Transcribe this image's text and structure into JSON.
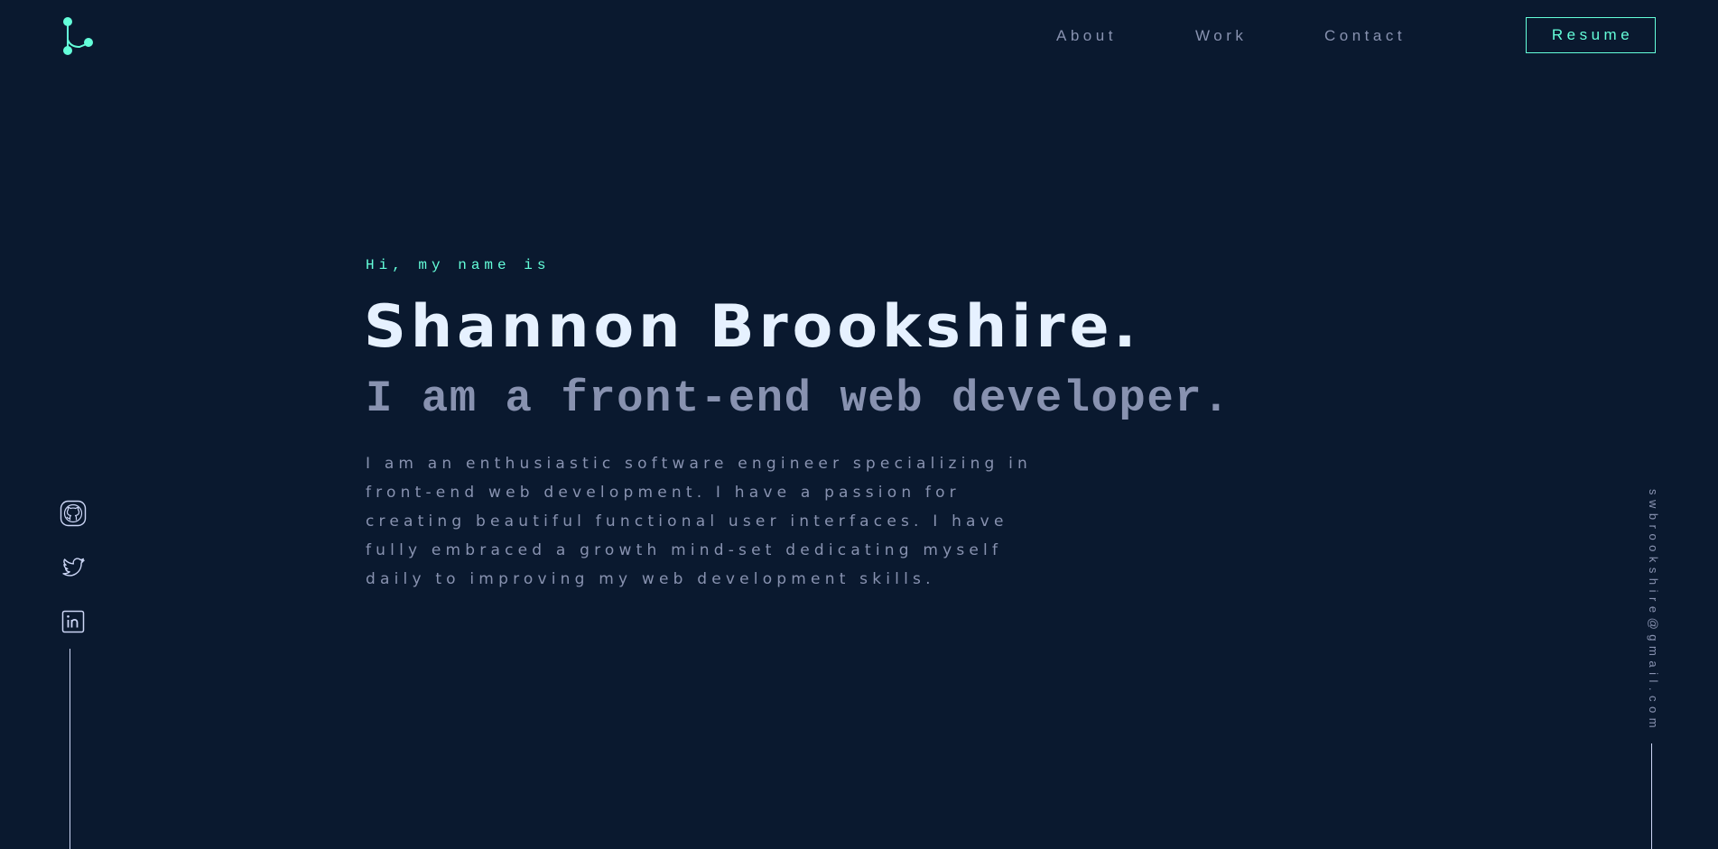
{
  "nav": {
    "links": [
      {
        "label": "About"
      },
      {
        "label": "Work"
      },
      {
        "label": "Contact"
      }
    ],
    "resume_label": "Resume"
  },
  "logo": {
    "icon": "logo-icon"
  },
  "hero": {
    "greeting": "Hi, my name is",
    "name": "Shannon Brookshire.",
    "tagline": "I am a front-end web developer.",
    "bio": "I am an enthusiastic software engineer specializing in front-end web development. I have a passion for creating beautiful functional user interfaces. I have fully embraced a growth mind-set dedicating myself daily to improving my web development skills."
  },
  "social": [
    {
      "icon": "github-icon"
    },
    {
      "icon": "twitter-icon"
    },
    {
      "icon": "linkedin-icon"
    }
  ],
  "email": "swbrookshire@gmail.com",
  "colors": {
    "background": "#0a192f",
    "accent": "#64ffda",
    "heading": "#e6f1ff",
    "text": "#8892b0"
  }
}
